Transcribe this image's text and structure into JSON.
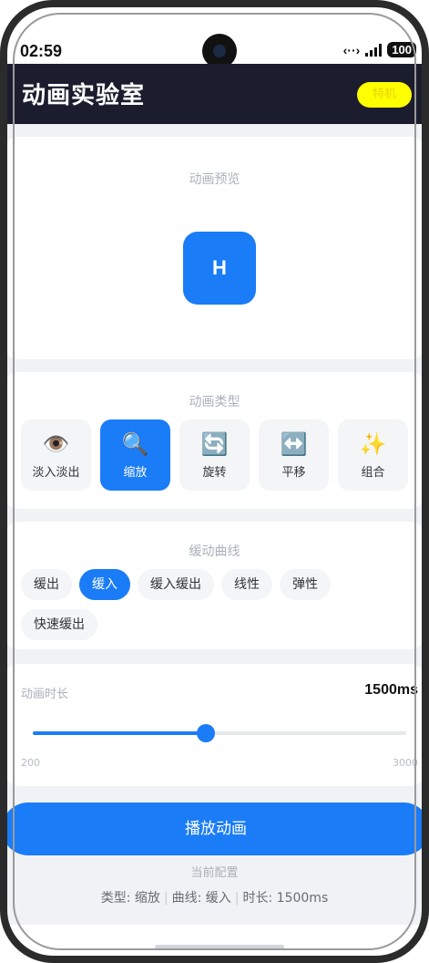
{
  "status_bar": {
    "time": "02:59",
    "battery": "100"
  },
  "header": {
    "title": "动画实验室",
    "badge": "特机"
  },
  "preview": {
    "title": "动画预览",
    "box_label": "H"
  },
  "animation_type": {
    "title": "动画类型",
    "options": [
      {
        "icon": "👁️",
        "icon_name": "eye-icon",
        "label": "淡入淡出",
        "active": false
      },
      {
        "icon": "🔍",
        "icon_name": "magnifier-icon",
        "label": "缩放",
        "active": true
      },
      {
        "icon": "🔄",
        "icon_name": "rotate-icon",
        "label": "旋转",
        "active": false
      },
      {
        "icon": "↔️",
        "icon_name": "left-right-arrow-icon",
        "label": "平移",
        "active": false
      },
      {
        "icon": "✨",
        "icon_name": "sparkles-icon",
        "label": "组合",
        "active": false
      }
    ]
  },
  "easing": {
    "title": "缓动曲线",
    "options": [
      {
        "label": "缓出",
        "active": false
      },
      {
        "label": "缓入",
        "active": true
      },
      {
        "label": "缓入缓出",
        "active": false
      },
      {
        "label": "线性",
        "active": false
      },
      {
        "label": "弹性",
        "active": false
      },
      {
        "label": "快速缓出",
        "active": false
      }
    ]
  },
  "duration": {
    "label": "动画时长",
    "value_text": "1500ms",
    "min_label": "200",
    "max_label": "3000",
    "min": 200,
    "max": 3000,
    "value": 1500
  },
  "play_button": {
    "label": "播放动画"
  },
  "config": {
    "title": "当前配置",
    "type_text": "类型: 缩放",
    "curve_text": "曲线: 缓入",
    "duration_text": "时长: 1500ms",
    "separator": "|"
  },
  "colors": {
    "accent": "#1a7cf7",
    "header_bg": "#1b1d2e",
    "badge_bg": "#ffff00"
  }
}
